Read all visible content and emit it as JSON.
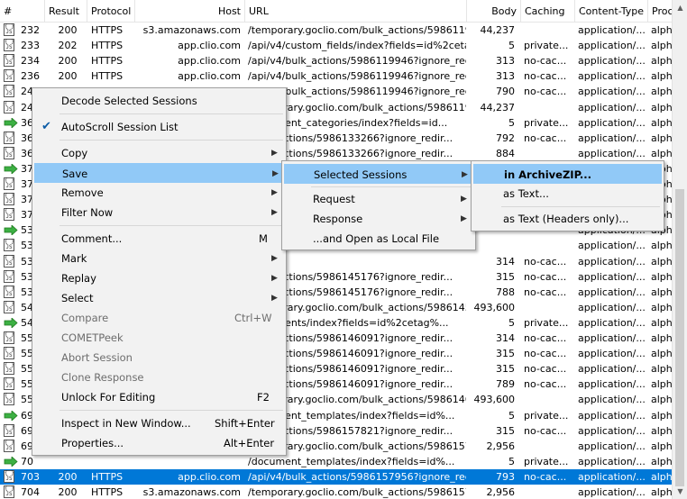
{
  "columns": [
    "#",
    "Result",
    "Protocol",
    "Host",
    "URL",
    "Body",
    "Caching",
    "Content-Type",
    "Proc"
  ],
  "rows": [
    {
      "icon": "js",
      "num": "232",
      "result": "200",
      "protocol": "HTTPS",
      "host": "s3.amazonaws.com",
      "url": "/temporary.goclio.com/bulk_actions/598611955...",
      "body": "44,237",
      "caching": "",
      "ctype": "application/...",
      "proc": "alpha"
    },
    {
      "icon": "js",
      "num": "233",
      "result": "202",
      "protocol": "HTTPS",
      "host": "app.clio.com",
      "url": "/api/v4/custom_fields/index?fields=id%2cetag...",
      "body": "5",
      "caching": "private...",
      "ctype": "application/...",
      "proc": "alpha"
    },
    {
      "icon": "js",
      "num": "234",
      "result": "200",
      "protocol": "HTTPS",
      "host": "app.clio.com",
      "url": "/api/v4/bulk_actions/5986119946?ignore_redir...",
      "body": "313",
      "caching": "no-cac...",
      "ctype": "application/...",
      "proc": "alpha"
    },
    {
      "icon": "js",
      "num": "236",
      "result": "200",
      "protocol": "HTTPS",
      "host": "app.clio.com",
      "url": "/api/v4/bulk_actions/5986119946?ignore_redir...",
      "body": "313",
      "caching": "no-cac...",
      "ctype": "application/...",
      "proc": "alpha"
    },
    {
      "icon": "js",
      "num": "24",
      "result": "",
      "protocol": "",
      "host": "",
      "url": "/api/v4/bulk_actions/5986119946?ignore_redir...",
      "body": "790",
      "caching": "no-cac...",
      "ctype": "application/...",
      "proc": "alpha"
    },
    {
      "icon": "js",
      "num": "24",
      "result": "",
      "protocol": "",
      "host": "",
      "url": "/temporary.goclio.com/bulk_actions/598611994...",
      "body": "44,237",
      "caching": "",
      "ctype": "application/...",
      "proc": "alpha"
    },
    {
      "icon": "arrow",
      "num": "36",
      "result": "",
      "protocol": "",
      "host": "",
      "url": "/document_categories/index?fields=id...",
      "body": "5",
      "caching": "private...",
      "ctype": "application/...",
      "proc": "alpha"
    },
    {
      "icon": "js",
      "num": "36",
      "result": "",
      "protocol": "",
      "host": "",
      "url": "/bulk_actions/5986133266?ignore_redir...",
      "body": "792",
      "caching": "no-cac...",
      "ctype": "application/...",
      "proc": "alpha"
    },
    {
      "icon": "js",
      "num": "36",
      "result": "",
      "protocol": "",
      "host": "",
      "url": "/bulk_actions/5986133266?ignore_redir...",
      "body": "884",
      "caching": "",
      "ctype": "application/...",
      "proc": "alpha"
    },
    {
      "icon": "arrow",
      "num": "37",
      "result": "",
      "protocol": "",
      "host": "",
      "url": "",
      "body": "",
      "caching": "",
      "ctype": "application/...",
      "proc": "alpha"
    },
    {
      "icon": "js",
      "num": "37",
      "result": "",
      "protocol": "",
      "host": "",
      "url": "",
      "body": "",
      "caching": "",
      "ctype": "application/...",
      "proc": "alpha"
    },
    {
      "icon": "js",
      "num": "37",
      "result": "",
      "protocol": "",
      "host": "",
      "url": "",
      "body": "",
      "caching": "",
      "ctype": "application/...",
      "proc": "alpha"
    },
    {
      "icon": "js",
      "num": "37",
      "result": "",
      "protocol": "",
      "host": "",
      "url": "",
      "body": "",
      "caching": "",
      "ctype": "application/...",
      "proc": "alpha"
    },
    {
      "icon": "arrow",
      "num": "53",
      "result": "",
      "protocol": "",
      "host": "",
      "url": "",
      "body": "",
      "caching": "",
      "ctype": "application/...",
      "proc": "alpha"
    },
    {
      "icon": "js",
      "num": "53",
      "result": "",
      "protocol": "",
      "host": "",
      "url": "",
      "body": "",
      "caching": "",
      "ctype": "application/...",
      "proc": "alpha"
    },
    {
      "icon": "js",
      "num": "53",
      "result": "",
      "protocol": "",
      "host": "",
      "url": "",
      "body": "314",
      "caching": "no-cac...",
      "ctype": "application/...",
      "proc": "alpha"
    },
    {
      "icon": "js",
      "num": "53",
      "result": "",
      "protocol": "",
      "host": "",
      "url": "/bulk_actions/5986145176?ignore_redir...",
      "body": "315",
      "caching": "no-cac...",
      "ctype": "application/...",
      "proc": "alpha"
    },
    {
      "icon": "js",
      "num": "53",
      "result": "",
      "protocol": "",
      "host": "",
      "url": "/bulk_actions/5986145176?ignore_redir...",
      "body": "788",
      "caching": "no-cac...",
      "ctype": "application/...",
      "proc": "alpha"
    },
    {
      "icon": "js",
      "num": "54",
      "result": "",
      "protocol": "",
      "host": "",
      "url": "/temporary.goclio.com/bulk_actions/598614517...",
      "body": "493,600",
      "caching": "",
      "ctype": "application/...",
      "proc": "alpha"
    },
    {
      "icon": "arrow",
      "num": "54",
      "result": "",
      "protocol": "",
      "host": "",
      "url": "/documents/index?fields=id%2cetag%...",
      "body": "5",
      "caching": "private...",
      "ctype": "application/...",
      "proc": "alpha"
    },
    {
      "icon": "js",
      "num": "55",
      "result": "",
      "protocol": "",
      "host": "",
      "url": "/bulk_actions/5986146091?ignore_redir...",
      "body": "314",
      "caching": "no-cac...",
      "ctype": "application/...",
      "proc": "alpha"
    },
    {
      "icon": "js",
      "num": "55",
      "result": "",
      "protocol": "",
      "host": "",
      "url": "/bulk_actions/5986146091?ignore_redir...",
      "body": "315",
      "caching": "no-cac...",
      "ctype": "application/...",
      "proc": "alpha"
    },
    {
      "icon": "js",
      "num": "55",
      "result": "",
      "protocol": "",
      "host": "",
      "url": "/bulk_actions/5986146091?ignore_redir...",
      "body": "315",
      "caching": "no-cac...",
      "ctype": "application/...",
      "proc": "alpha"
    },
    {
      "icon": "js",
      "num": "55",
      "result": "",
      "protocol": "",
      "host": "",
      "url": "/bulk_actions/5986146091?ignore_redir...",
      "body": "789",
      "caching": "no-cac...",
      "ctype": "application/...",
      "proc": "alpha"
    },
    {
      "icon": "js",
      "num": "55",
      "result": "",
      "protocol": "",
      "host": "",
      "url": "/temporary.goclio.com/bulk_actions/598614609...",
      "body": "493,600",
      "caching": "",
      "ctype": "application/...",
      "proc": "alpha"
    },
    {
      "icon": "arrow",
      "num": "69",
      "result": "",
      "protocol": "",
      "host": "",
      "url": "/document_templates/index?fields=id%...",
      "body": "5",
      "caching": "private...",
      "ctype": "application/...",
      "proc": "alpha"
    },
    {
      "icon": "js",
      "num": "69",
      "result": "",
      "protocol": "",
      "host": "",
      "url": "/bulk_actions/5986157821?ignore_redir...",
      "body": "315",
      "caching": "no-cac...",
      "ctype": "application/...",
      "proc": "alpha"
    },
    {
      "icon": "js",
      "num": "69",
      "result": "",
      "protocol": "",
      "host": "",
      "url": "/temporary.goclio.com/bulk_actions/598615782...",
      "body": "2,956",
      "caching": "",
      "ctype": "application/...",
      "proc": "alpha"
    },
    {
      "icon": "arrow",
      "num": "70",
      "result": "",
      "protocol": "",
      "host": "",
      "url": "/document_templates/index?fields=id%...",
      "body": "5",
      "caching": "private...",
      "ctype": "application/...",
      "proc": "alpha"
    },
    {
      "icon": "js",
      "num": "703",
      "result": "200",
      "protocol": "HTTPS",
      "host": "app.clio.com",
      "url": "/api/v4/bulk_actions/5986157956?ignore_redir...",
      "body": "793",
      "caching": "no-cac...",
      "ctype": "application/...",
      "proc": "alpha",
      "selected": true
    },
    {
      "icon": "js",
      "num": "704",
      "result": "200",
      "protocol": "HTTPS",
      "host": "s3.amazonaws.com",
      "url": "/temporary.goclio.com/bulk_actions/598615795...",
      "body": "2,956",
      "caching": "",
      "ctype": "application/...",
      "proc": "alpha"
    }
  ],
  "context_menu": {
    "items": [
      {
        "label": "Decode Selected Sessions",
        "shortcut": "",
        "sub": false,
        "disabled": false,
        "checked": false
      },
      {
        "label": "AutoScroll Session List",
        "shortcut": "",
        "sub": false,
        "disabled": false,
        "checked": true
      },
      {
        "label": "Copy",
        "shortcut": "",
        "sub": true,
        "disabled": false,
        "checked": false
      },
      {
        "label": "Save",
        "shortcut": "",
        "sub": true,
        "disabled": false,
        "checked": false,
        "highlight": true
      },
      {
        "label": "Remove",
        "shortcut": "",
        "sub": true,
        "disabled": false,
        "checked": false
      },
      {
        "label": "Filter Now",
        "shortcut": "",
        "sub": true,
        "disabled": false,
        "checked": false
      },
      {
        "label": "Comment...",
        "shortcut": "M",
        "sub": false,
        "disabled": false,
        "checked": false
      },
      {
        "label": "Mark",
        "shortcut": "",
        "sub": true,
        "disabled": false,
        "checked": false
      },
      {
        "label": "Replay",
        "shortcut": "",
        "sub": true,
        "disabled": false,
        "checked": false
      },
      {
        "label": "Select",
        "shortcut": "",
        "sub": true,
        "disabled": false,
        "checked": false
      },
      {
        "label": "Compare",
        "shortcut": "Ctrl+W",
        "sub": false,
        "disabled": true,
        "checked": false
      },
      {
        "label": "COMETPeek",
        "shortcut": "",
        "sub": false,
        "disabled": true,
        "checked": false
      },
      {
        "label": "Abort Session",
        "shortcut": "",
        "sub": false,
        "disabled": true,
        "checked": false
      },
      {
        "label": "Clone Response",
        "shortcut": "",
        "sub": false,
        "disabled": true,
        "checked": false
      },
      {
        "label": "Unlock For Editing",
        "shortcut": "F2",
        "sub": false,
        "disabled": false,
        "checked": false
      },
      {
        "label": "Inspect in New Window...",
        "shortcut": "Shift+Enter",
        "sub": false,
        "disabled": false,
        "checked": false
      },
      {
        "label": "Properties...",
        "shortcut": "Alt+Enter",
        "sub": false,
        "disabled": false,
        "checked": false
      }
    ]
  },
  "save_submenu": {
    "items": [
      {
        "label": "Selected Sessions",
        "sub": true,
        "highlight": true
      },
      {
        "label": "Request",
        "sub": true
      },
      {
        "label": "Response",
        "sub": true
      },
      {
        "label": "...and Open as Local File",
        "sub": false
      }
    ]
  },
  "selected_sessions_submenu": {
    "items": [
      {
        "label": "in ArchiveZIP...",
        "bold": true,
        "highlight": true
      },
      {
        "label": "as Text...",
        "bold": false
      },
      {
        "label": "as Text (Headers only)...",
        "bold": false
      }
    ]
  },
  "colors": {
    "selection": "#0078d7",
    "menu_highlight": "#91c9f7",
    "arrow_green": "#3cb043"
  }
}
